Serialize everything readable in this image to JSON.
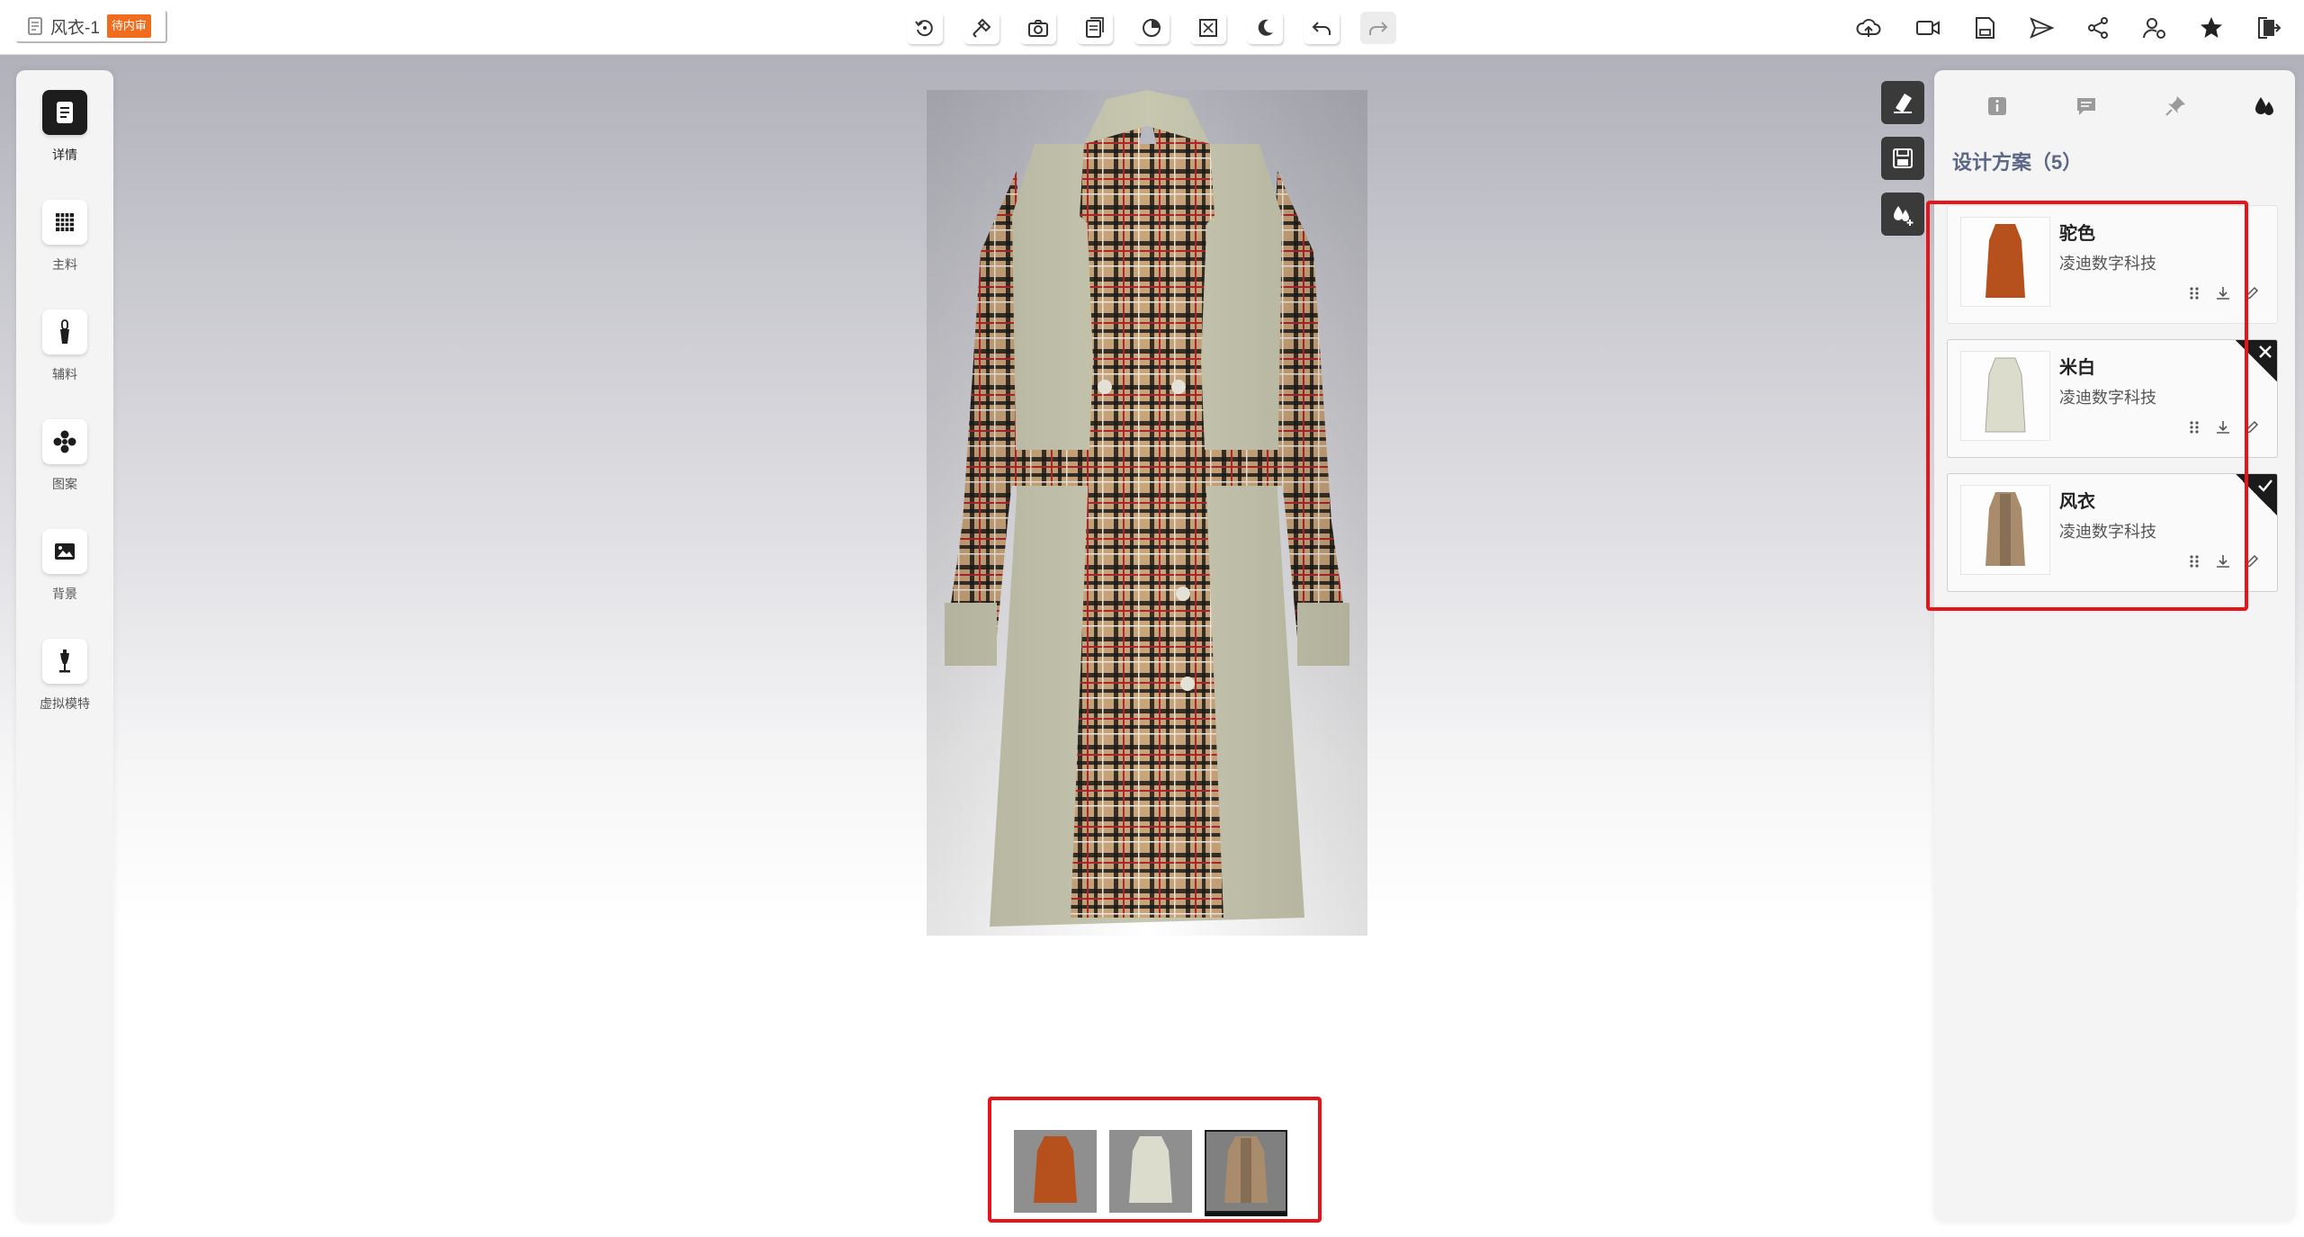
{
  "document": {
    "title": "风衣-1",
    "status": "待内审"
  },
  "toolbar": {
    "center_icons": [
      "rotate-icon",
      "measure-tool-icon",
      "camera-icon",
      "copy-pages-icon",
      "timer-icon",
      "fullscreen-icon",
      "night-mode-icon",
      "undo-icon",
      "redo-icon"
    ],
    "right_icons": [
      "cloud-upload-icon",
      "video-icon",
      "save-drive-icon",
      "send-icon",
      "share-icon",
      "user-settings-icon",
      "star-icon",
      "exit-icon"
    ]
  },
  "sidebar": {
    "items": [
      {
        "label": "详情",
        "icon": "document-icon",
        "active": true
      },
      {
        "label": "主料",
        "icon": "fabric-grid-icon",
        "active": false
      },
      {
        "label": "辅料",
        "icon": "zipper-icon",
        "active": false
      },
      {
        "label": "图案",
        "icon": "pattern-icon",
        "active": false
      },
      {
        "label": "背景",
        "icon": "background-image-icon",
        "active": false
      },
      {
        "label": "虚拟模特",
        "icon": "mannequin-icon",
        "active": false
      }
    ]
  },
  "float_tools": [
    "eraser-icon",
    "save-icon",
    "color-drops-add-icon"
  ],
  "panel": {
    "tabs": [
      "info-icon",
      "comment-icon",
      "pin-icon",
      "color-drops-icon"
    ],
    "section_title": "设计方案（5）",
    "schemes": [
      {
        "name": "驼色",
        "brand": "凌迪数字科技",
        "color": "#b6501c",
        "marker": "none"
      },
      {
        "name": "米白",
        "brand": "凌迪数字科技",
        "color": "#dcdccd",
        "marker": "close"
      },
      {
        "name": "风衣",
        "brand": "凌迪数字科技",
        "color": "#a88c6b",
        "marker": "check"
      }
    ]
  },
  "thumbnails": [
    {
      "name": "驼色",
      "color": "#b6501c",
      "selected": false
    },
    {
      "name": "米白",
      "color": "#dcdccd",
      "selected": false
    },
    {
      "name": "风衣",
      "color": "#a88c6b",
      "selected": true
    }
  ],
  "colors": {
    "accent_red": "#e8141b",
    "status_orange": "#f26c1d",
    "garment_base": "#c8c7b0",
    "check_beige": "#c9a57b"
  }
}
